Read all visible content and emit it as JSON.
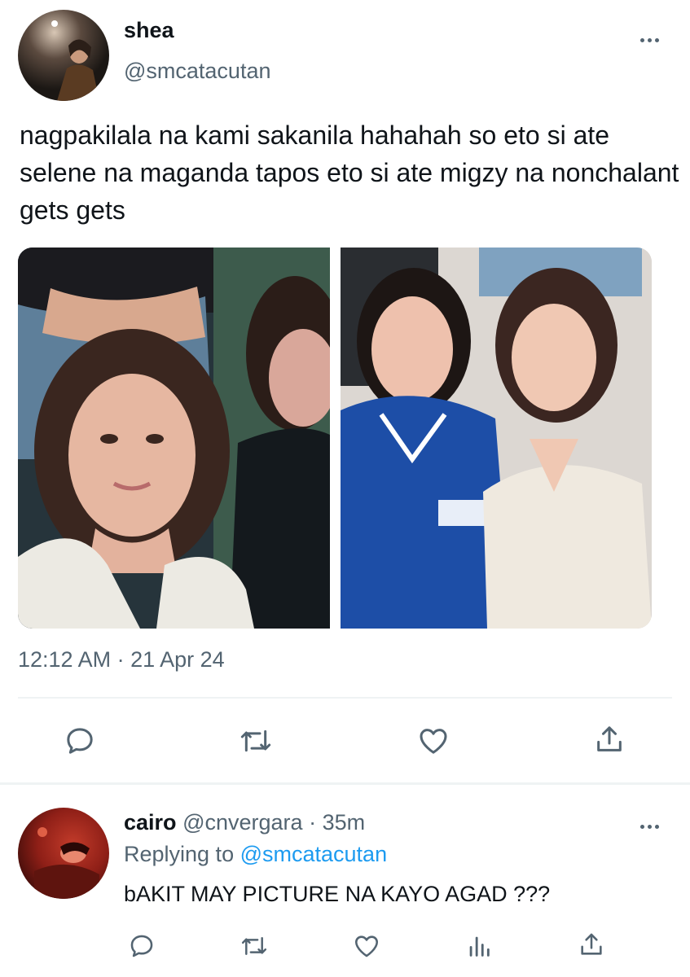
{
  "main_tweet": {
    "display_name": "shea",
    "handle": "@smcatacutan",
    "text": "nagpakilala na kami sakanila hahahah so eto si ate selene na maganda tapos eto si ate migzy na nonchalant gets gets",
    "timestamp": "12:12 AM · 21 Apr 24",
    "actions": [
      "reply-icon",
      "retweet-icon",
      "like-icon",
      "share-icon"
    ]
  },
  "reply": {
    "display_name": "cairo",
    "handle": "@cnvergara",
    "separator": "·",
    "time": "35m",
    "replying_prefix": "Replying to",
    "replying_to": "@smcatacutan",
    "text": "bAKIT MAY PICTURE NA KAYO AGAD ???",
    "actions": [
      "reply-icon",
      "retweet-icon",
      "like-icon",
      "analytics-icon",
      "share-icon"
    ]
  },
  "colors": {
    "text_primary": "#0f1419",
    "text_secondary": "#536471",
    "accent": "#1d9bf0",
    "divider": "#eff3f4"
  }
}
